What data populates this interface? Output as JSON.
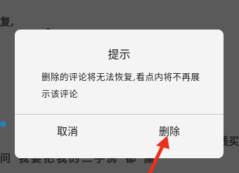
{
  "background": {
    "top_text": "复,",
    "right_text": "线买",
    "bottom_text": "问  我要把我的二手房   都  屋"
  },
  "dialog": {
    "title": "提示",
    "message": "删除的评论将无法恢复,看点内将不再展示该评论",
    "cancel_label": "取消",
    "delete_label": "删除"
  },
  "colors": {
    "overlay": "#5a5a5a",
    "dialog_bg": "#f4f4f4",
    "annotation_arrow": "#e8321d"
  }
}
